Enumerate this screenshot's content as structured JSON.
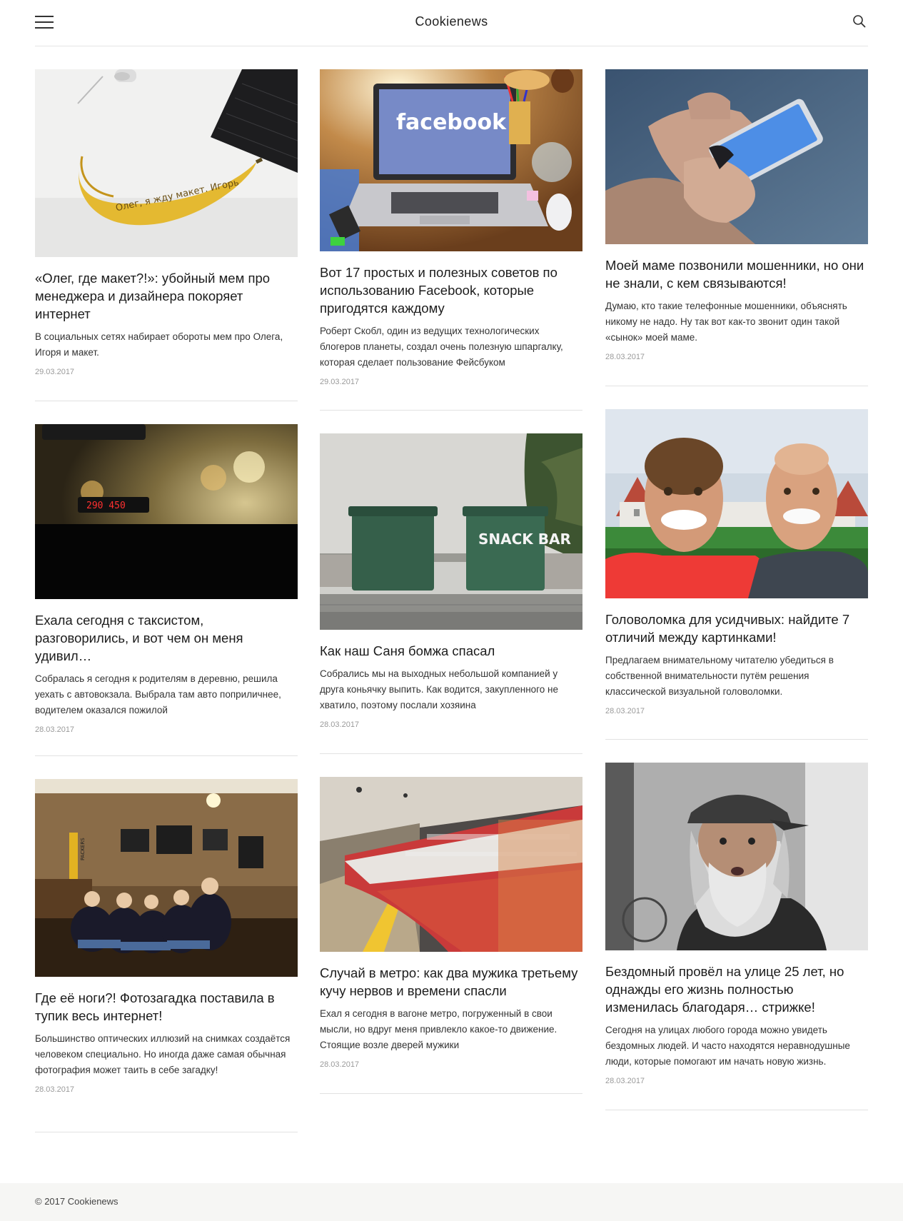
{
  "header": {
    "brand": "Cookienews",
    "menu_icon": "hamburger-menu-icon",
    "search_icon": "search-icon"
  },
  "articles": [
    {
      "title": "«Олег, где макет?!»: убойный мем про менеджера и дизайнера покоряет интернет",
      "excerpt": "В социальных сетях набирает обороты мем про Олега, Игоря и макет.",
      "date": "29.03.2017",
      "image_text": "Олег, я жду макет. Игорь"
    },
    {
      "title": "Вот 17 простых и полезных советов по использованию Facebook, которые пригодятся каждому",
      "excerpt": "Роберт Скобл, один из ведущих технологических блогеров планеты, создал очень полезную шпаргалку, которая сделает пользование Фейсбуком",
      "date": "29.03.2017",
      "image_text": "facebook"
    },
    {
      "title": "Моей маме позвонили мошенники, но они не знали, с кем связываются!",
      "excerpt": "Думаю, кто такие телефонные мошенники, объяснять никому не надо. Ну так вот как-то звонит один такой «сынок» моей маме.",
      "date": "28.03.2017"
    },
    {
      "title": "Ехала сегодня с таксистом, разговорились, и вот чем он меня удивил…",
      "excerpt": "Собралась я сегодня к родителям в деревню, решила уехать с автовокзала. Выбрала там авто поприличнее, водителем оказался пожилой",
      "date": "28.03.2017",
      "image_text": "290 450"
    },
    {
      "title": "Как наш Саня бомжа спасал",
      "excerpt": "Собрались мы на выходных небольшой компанией у друга коньячку выпить. Как водится, закупленного не хватило, поэтому послали хозяина",
      "date": "28.03.2017",
      "image_text": "SNACK BAR"
    },
    {
      "title": "Головоломка для усидчивых: найдите 7 отличий между картинками!",
      "excerpt": "Предлагаем внимательному читателю убедиться в собственной внимательности путём решения классической визуальной головоломки.",
      "date": "28.03.2017"
    },
    {
      "title": "Где её ноги?! Фотозагадка поставила в тупик весь интернет!",
      "excerpt": "Большинство оптических иллюзий на снимках создаётся человеком специально. Но иногда даже самая обычная фотография может таить в себе загадку!",
      "date": "28.03.2017",
      "image_text": "PACKERS"
    },
    {
      "title": "Случай в метро: как два мужика третьему кучу нервов и времени спасли",
      "excerpt": "Ехал я сегодня в вагоне метро, погруженный в свои мысли, но вдруг меня привлекло какое-то движение. Стоящие возле дверей мужики",
      "date": "28.03.2017"
    },
    {
      "title": "Бездомный провёл на улице 25 лет, но однажды его жизнь полностью изменилась благодаря… стрижке!",
      "excerpt": "Сегодня на улицах любого города можно увидеть бездомных людей. И часто находятся неравнодушные люди, которые помогают им начать новую жизнь.",
      "date": "28.03.2017"
    }
  ],
  "footer": {
    "copyright": "© 2017 Cookienews"
  }
}
